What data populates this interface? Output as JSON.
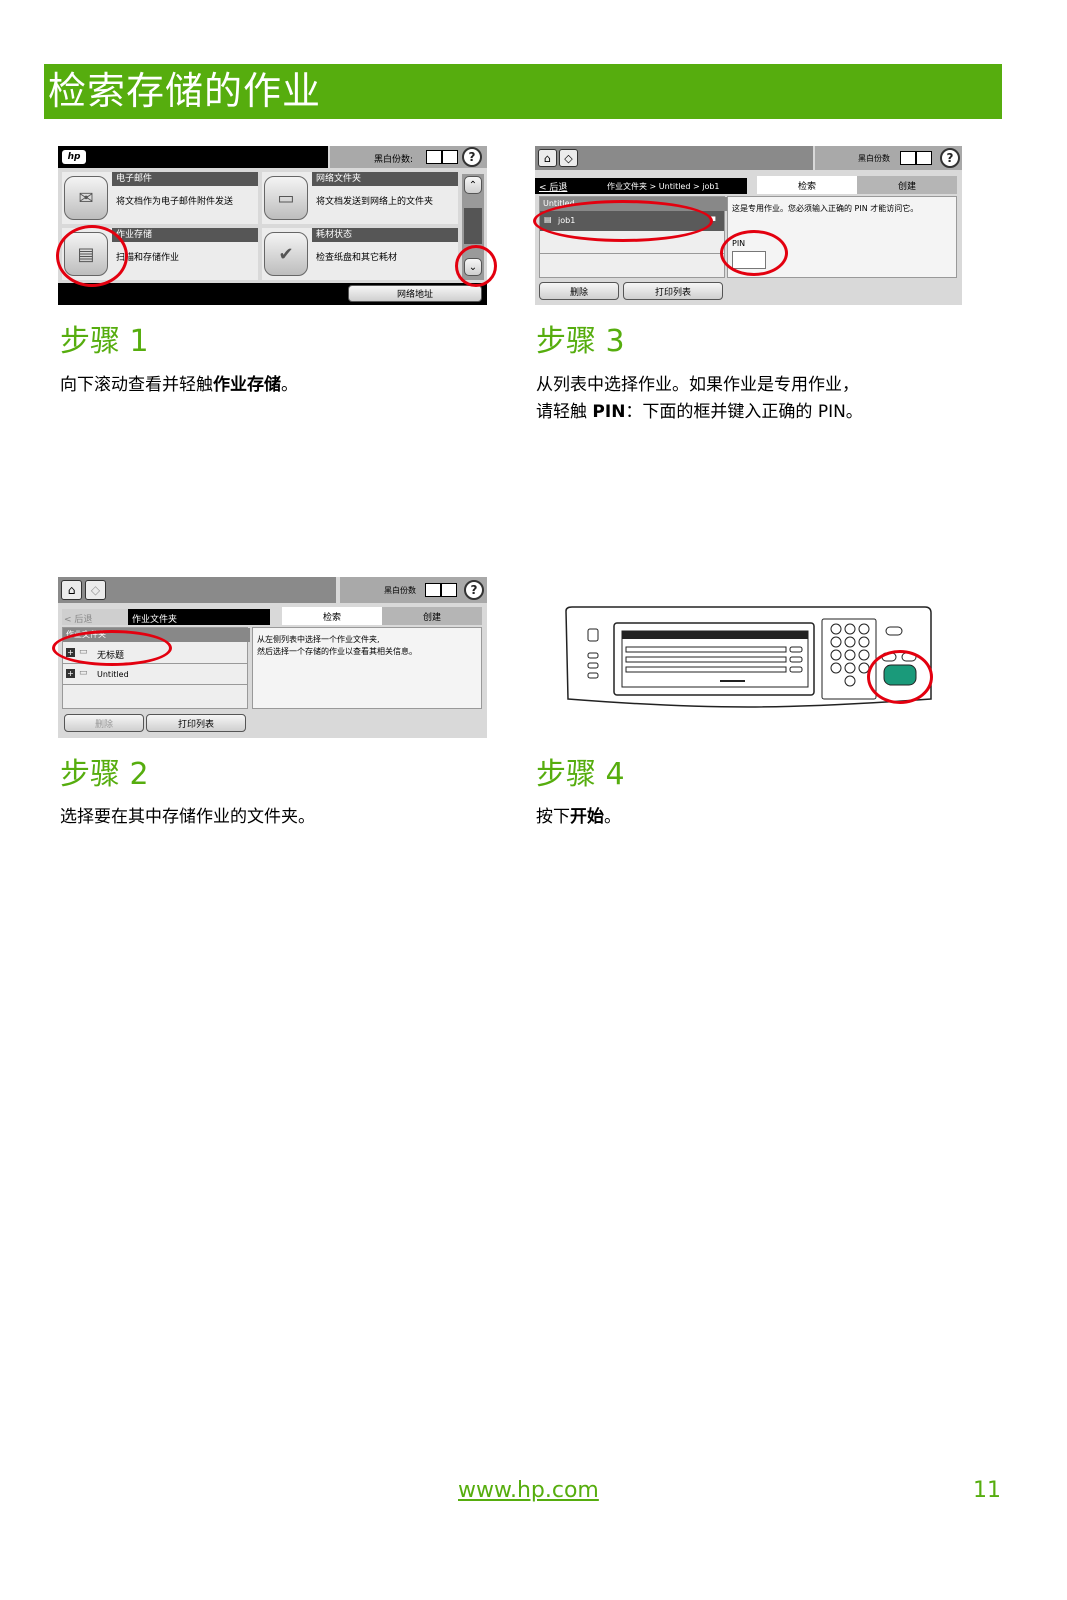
{
  "title": "检索存储的作业",
  "colors": {
    "brand_green": "#56ad0e",
    "highlight_red": "#e3000f"
  },
  "steps": [
    {
      "heading": "步骤 1",
      "text_pre": "向下滚动查看并轻触",
      "text_bold": "作业存储",
      "text_post": "。"
    },
    {
      "heading": "步骤 2",
      "text": "选择要在其中存储作业的文件夹。"
    },
    {
      "heading": "步骤 3",
      "line1": "从列表中选择作业。如果作业是专用作业，",
      "line2_pre": "请轻触 ",
      "line2_bold": "PIN",
      "line2_post": "：下面的框并键入正确的 PIN。"
    },
    {
      "heading": "步骤 4",
      "text_pre": "按下",
      "text_bold": "开始",
      "text_post": "。"
    }
  ],
  "screen1": {
    "logo": "hp",
    "copies_label": "黑白份数:",
    "help_icon": "?",
    "tiles": [
      {
        "title": "电子邮件",
        "desc": "将文档作为电子邮件附件发送",
        "icon": "envelope-icon"
      },
      {
        "title": "网络文件夹",
        "desc": "将文档发送到网络上的文件夹",
        "icon": "folder-icon"
      },
      {
        "title": "作业存储",
        "desc": "扫描和存储作业",
        "icon": "storage-icon"
      },
      {
        "title": "耗材状态",
        "desc": "检查纸盘和其它耗材",
        "icon": "supplies-icon"
      }
    ],
    "network_button": "网络地址"
  },
  "screen2": {
    "copies_label": "黑白份数",
    "back": "< 后退",
    "path": "作业文件夹",
    "tab_retrieve": "检索",
    "tab_create": "创建",
    "list_header": "作业文件夹",
    "folders": [
      "无标题",
      "Untitled"
    ],
    "info_line1": "从左侧列表中选择一个作业文件夹,",
    "info_line2": "然后选择一个存储的作业以查看其相关信息。",
    "delete_button": "删除",
    "print_list_button": "打印列表"
  },
  "screen3": {
    "copies_label": "黑白份数",
    "back": "< 后退",
    "path": "作业文件夹 > Untitled > job1",
    "tab_retrieve": "检索",
    "tab_create": "创建",
    "list_header": "Untitled",
    "job": "job1",
    "message": "这是专用作业。您必须输入正确的 PIN 才能访问它。",
    "pin_label": "PIN",
    "delete_button": "删除",
    "print_list_button": "打印列表"
  },
  "footer": {
    "url": "www.hp.com",
    "page_number": "11"
  }
}
